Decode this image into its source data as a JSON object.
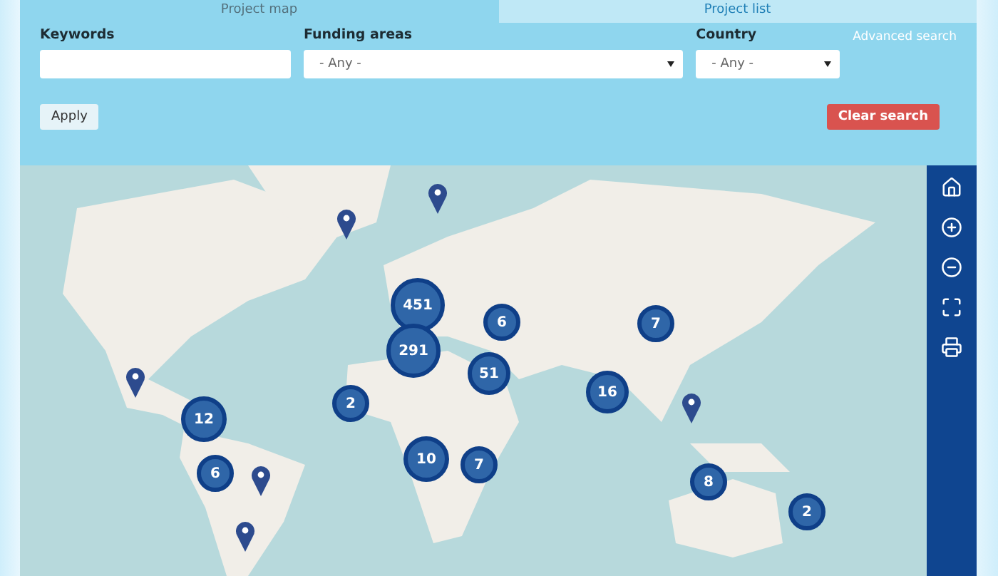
{
  "tabs": [
    {
      "label": "Project map",
      "selected": true
    },
    {
      "label": "Project list",
      "selected": false
    }
  ],
  "filters": {
    "keywords": {
      "label": "Keywords"
    },
    "funding_areas": {
      "label": "Funding areas",
      "value": "- Any -"
    },
    "country": {
      "label": "Country",
      "value": "- Any -"
    },
    "advanced_search": "Advanced search",
    "apply": "Apply",
    "clear": "Clear search"
  },
  "map": {
    "kind": "picture",
    "clusters": [
      "451",
      "291",
      "6",
      "51",
      "2",
      "12",
      "6",
      "10",
      "7",
      "7",
      "16",
      "8",
      "2"
    ]
  },
  "map_tools": [
    {
      "kind": "home"
    },
    {
      "kind": "zoom-in"
    },
    {
      "kind": "zoom-out"
    },
    {
      "kind": "fullscreen"
    },
    {
      "kind": "print"
    }
  ]
}
